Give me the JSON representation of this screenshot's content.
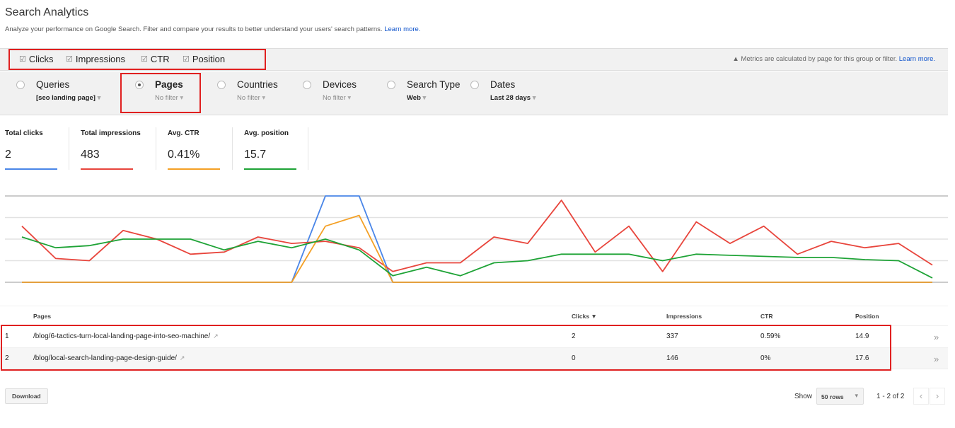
{
  "header": {
    "title": "Search Analytics",
    "subtitle": "Analyze your performance on Google Search. Filter and compare your results to better understand your users' search patterns.",
    "subtitle_link": "Learn more."
  },
  "metrics": [
    {
      "label": "Clicks",
      "checked": true
    },
    {
      "label": "Impressions",
      "checked": true
    },
    {
      "label": "CTR",
      "checked": true
    },
    {
      "label": "Position",
      "checked": true
    }
  ],
  "notice": {
    "icon": "warning-icon",
    "glyph": "▲",
    "text": "Metrics are calculated by page for this group or filter.",
    "link": "Learn more."
  },
  "filters": [
    {
      "label": "Queries",
      "value": "[seo landing page]",
      "selected": false,
      "value_bold": true
    },
    {
      "label": "Pages",
      "value": "No filter",
      "selected": true,
      "value_bold": false
    },
    {
      "label": "Countries",
      "value": "No filter",
      "selected": false,
      "value_bold": false
    },
    {
      "label": "Devices",
      "value": "No filter",
      "selected": false,
      "value_bold": false
    },
    {
      "label": "Search Type",
      "value": "Web",
      "selected": false,
      "value_bold": true
    },
    {
      "label": "Dates",
      "value": "Last 28 days",
      "selected": false,
      "value_bold": true
    }
  ],
  "dropdown_glyph": "▾",
  "stats": [
    {
      "label": "Total clicks",
      "value": "2",
      "color": "#4a86e8"
    },
    {
      "label": "Total impressions",
      "value": "483",
      "color": "#e8453c"
    },
    {
      "label": "Avg. CTR",
      "value": "0.41%",
      "color": "#f4a025"
    },
    {
      "label": "Avg. position",
      "value": "15.7",
      "color": "#1ea336"
    }
  ],
  "chart_data": {
    "type": "line",
    "title": "",
    "xlabel": "",
    "ylabel": "",
    "x": [
      1,
      2,
      3,
      4,
      5,
      6,
      7,
      8,
      9,
      10,
      11,
      12,
      13,
      14,
      15,
      16,
      17,
      18,
      19,
      20,
      21,
      22,
      23,
      24,
      25,
      26,
      27,
      28
    ],
    "ylim": [
      0,
      4
    ],
    "grid": true,
    "legend": "none",
    "units_note": "values in relative gridline units (4 gridline bands)",
    "series": [
      {
        "name": "Clicks",
        "color": "#4a86e8",
        "values": [
          0,
          0,
          0,
          0,
          0,
          0,
          0,
          0,
          0,
          4,
          4,
          0,
          0,
          0,
          0,
          0,
          0,
          0,
          0,
          0,
          0,
          0,
          0,
          0,
          0,
          0,
          0,
          0
        ]
      },
      {
        "name": "Impressions",
        "color": "#e8453c",
        "values": [
          2.6,
          1.1,
          1.0,
          2.4,
          2.0,
          1.3,
          1.4,
          2.1,
          1.8,
          1.9,
          1.6,
          0.5,
          0.9,
          0.9,
          2.1,
          1.8,
          3.8,
          1.4,
          2.6,
          0.5,
          2.8,
          1.8,
          2.6,
          1.3,
          1.9,
          1.6,
          1.8,
          0.8
        ]
      },
      {
        "name": "CTR",
        "color": "#f4a025",
        "values": [
          0,
          0,
          0,
          0,
          0,
          0,
          0,
          0,
          0,
          2.6,
          3.1,
          0,
          0,
          0,
          0,
          0,
          0,
          0,
          0,
          0,
          0,
          0,
          0,
          0,
          0,
          0,
          0,
          0
        ]
      },
      {
        "name": "Position",
        "color": "#1ea336",
        "values": [
          2.1,
          1.6,
          1.7,
          2.0,
          2.0,
          2.0,
          1.5,
          1.9,
          1.6,
          2.0,
          1.5,
          0.3,
          0.7,
          0.3,
          0.9,
          1.0,
          1.3,
          1.3,
          1.3,
          1.0,
          1.3,
          1.25,
          1.2,
          1.15,
          1.15,
          1.05,
          1.0,
          0.2
        ]
      }
    ]
  },
  "table": {
    "columns": [
      "Pages",
      "Clicks ▼",
      "Impressions",
      "CTR",
      "Position"
    ],
    "rows": [
      {
        "index": "1",
        "page": "/blog/6-tactics-turn-local-landing-page-into-seo-machine/",
        "clicks": "2",
        "impressions": "337",
        "ctr": "0.59%",
        "position": "14.9"
      },
      {
        "index": "2",
        "page": "/blog/local-search-landing-page-design-guide/",
        "clicks": "0",
        "impressions": "146",
        "ctr": "0%",
        "position": "17.6"
      }
    ],
    "ext_glyph": "↗",
    "more_glyph": "»"
  },
  "footer": {
    "download": "Download",
    "show": "Show",
    "rows_option": "50 rows",
    "range": "1 - 2 of 2",
    "prev": "‹",
    "next": "›"
  }
}
